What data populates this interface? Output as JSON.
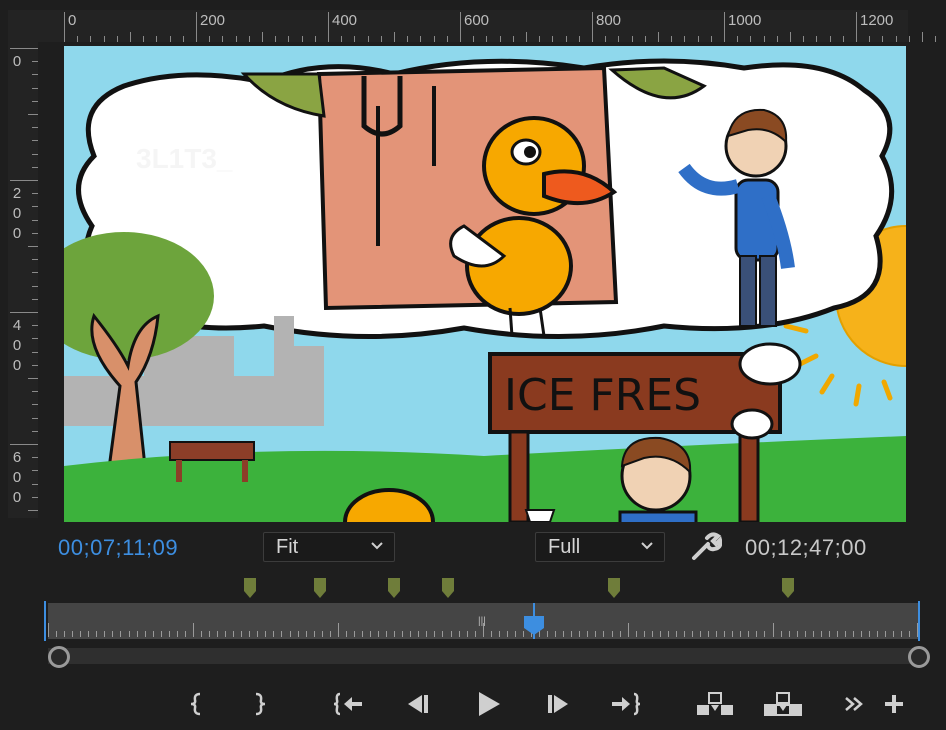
{
  "ruler": {
    "horizontal_labels": [
      "0",
      "200",
      "400",
      "600",
      "800",
      "1000",
      "1200"
    ],
    "vertical_labels": [
      [
        "0"
      ],
      [
        "2",
        "0",
        "0"
      ],
      [
        "4",
        "0",
        "0"
      ],
      [
        "6",
        "0",
        "0"
      ]
    ]
  },
  "frame": {
    "sign_text": "ICE FRES",
    "watermark": "3L1T3_"
  },
  "controls": {
    "current_timecode": "00;07;11;09",
    "zoom_select": "Fit",
    "quality_select": "Full",
    "duration_timecode": "00;12;47;00"
  },
  "timeline": {
    "marker_count": 6,
    "playhead_position_fraction": 0.56
  },
  "colors": {
    "accent": "#3d8ee0",
    "marker": "#6f7d3a",
    "sky": "#8fd8ec",
    "grass": "#3cb23c"
  },
  "transport": {
    "buttons": [
      {
        "name": "mark-in-button",
        "icon": "mark-in-icon"
      },
      {
        "name": "mark-out-button",
        "icon": "mark-out-icon"
      },
      {
        "name": "go-to-in-button",
        "icon": "go-to-in-icon"
      },
      {
        "name": "step-back-button",
        "icon": "step-back-icon"
      },
      {
        "name": "play-button",
        "icon": "play-icon"
      },
      {
        "name": "step-forward-button",
        "icon": "step-forward-icon"
      },
      {
        "name": "go-to-out-button",
        "icon": "go-to-out-icon"
      },
      {
        "name": "insert-button",
        "icon": "insert-icon"
      },
      {
        "name": "overwrite-button",
        "icon": "overwrite-icon"
      },
      {
        "name": "more-button",
        "icon": "double-chevron-right-icon"
      },
      {
        "name": "add-button",
        "icon": "plus-icon"
      }
    ]
  }
}
